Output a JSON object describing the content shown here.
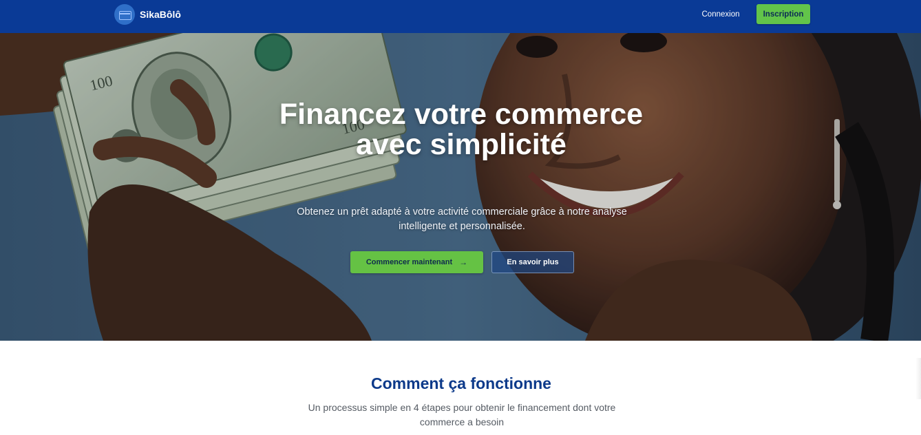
{
  "header": {
    "brand": "SikaBôlô",
    "logo_icon": "wallet-icon",
    "login_label": "Connexion",
    "signup_label": "Inscription",
    "colors": {
      "bar": "#0a3a96",
      "signup": "#62c44a"
    }
  },
  "hero": {
    "title": "Financez votre commerce avec simplicité",
    "subtitle": "Obtenez un prêt adapté à votre activité commerciale grâce à notre analyse intelligente et personnalisée.",
    "primary_cta": "Commencer maintenant",
    "primary_icon": "arrow-right-icon",
    "secondary_cta": "En savoir plus"
  },
  "how_it_works": {
    "title": "Comment ça fonctionne",
    "subtitle": "Un processus simple en 4 étapes pour obtenir le financement dont votre commerce a besoin"
  }
}
